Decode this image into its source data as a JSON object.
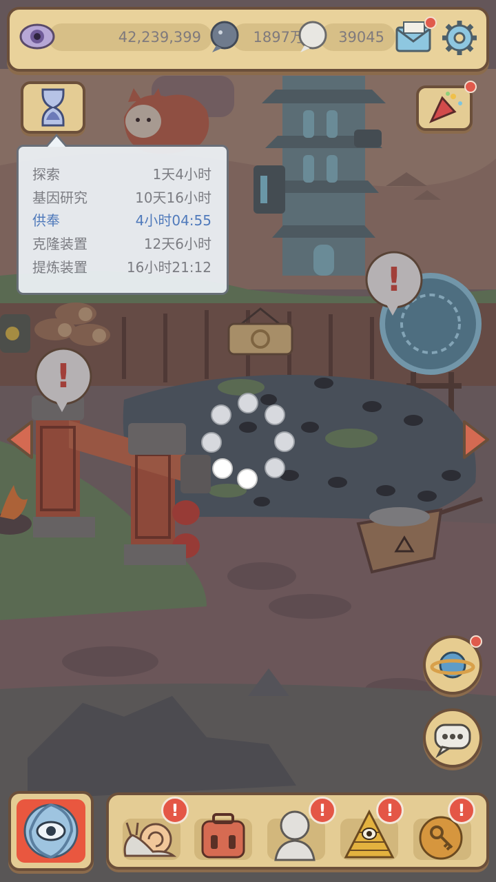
{
  "resources": {
    "eyes": "42,239,399",
    "bubbles": "1897万",
    "speech": "39045"
  },
  "tooltip": {
    "rows": [
      {
        "label": "探索",
        "value": "1天4小时"
      },
      {
        "label": "基因研究",
        "value": "10天16小时"
      },
      {
        "label": "供奉",
        "value": "4小时04:55"
      },
      {
        "label": "克隆装置",
        "value": "12天6小时"
      },
      {
        "label": "提炼装置",
        "value": "16小时21:12"
      }
    ],
    "highlight_color": "#4d7cc3"
  },
  "icons": {
    "resource_1": "eye-icon",
    "resource_2": "dark-bubble-icon",
    "resource_3": "speech-bubble-icon",
    "mail": "mail-icon",
    "settings": "gear-icon",
    "timer": "hourglass-icon",
    "event": "party-popper-icon",
    "left": "left-arrow-icon",
    "right": "right-arrow-icon",
    "planet": "planet-icon",
    "chat": "chat-icon",
    "vortex": "vortex-eye-icon",
    "bottom": [
      "snail-icon",
      "suitcase-icon",
      "bust-statue-icon",
      "pyramid-eye-icon",
      "key-coin-icon"
    ]
  },
  "bottom_alerts": [
    "!",
    "!",
    "!",
    "!",
    "!"
  ],
  "scene_alerts": [
    "!",
    "!"
  ],
  "colors": {
    "panel": "#e9d29b",
    "border": "#6b4f3a",
    "alert": "#e45646"
  }
}
